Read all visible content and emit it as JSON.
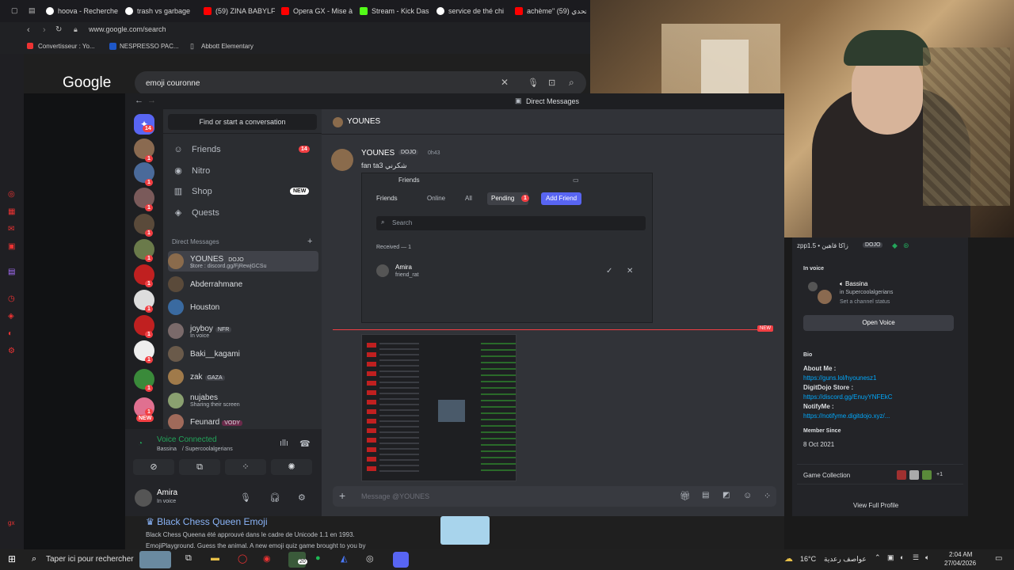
{
  "browser": {
    "tabs": [
      {
        "label": "hoova - Recherche",
        "color": "#ffffff"
      },
      {
        "label": "trash vs garbage",
        "color": "#ffffff"
      },
      {
        "label": "(59) ZINA BABYLF",
        "color": "#ff0000"
      },
      {
        "label": "Opera GX - Mise à",
        "color": "#ff0000"
      },
      {
        "label": "Stream - Kick Das",
        "color": "#53fc18"
      },
      {
        "label": "service de thé chi",
        "color": "#ffffff"
      },
      {
        "label": "‏achème\" تحدي (59)",
        "color": "#ff0000"
      }
    ],
    "url": "www.google.com/search",
    "bookmarks": [
      "Convertisseur : Yo...",
      "NESPRESSO PAC...",
      "Abbott Elementary"
    ],
    "search_query": "emoji couronne",
    "google_logo": "Google"
  },
  "discord": {
    "top_title": "Direct Messages",
    "find_placeholder": "Find or start a conversation",
    "nav": {
      "friends": "Friends",
      "friends_badge": "14",
      "nitro": "Nitro",
      "shop": "Shop",
      "shop_badge": "NEW",
      "quests": "Quests"
    },
    "dm_header": "Direct Messages",
    "dms": [
      {
        "name": "YOUNES",
        "tag": "DOJO",
        "sub": "$tore : discord.gg/FjRewjGCSu",
        "color": "#8a6b4c"
      },
      {
        "name": "Abderrahmane",
        "tag": "",
        "sub": "",
        "color": "#5a4a3a"
      },
      {
        "name": "Houston",
        "tag": "",
        "sub": "",
        "color": "#3a6aa0"
      },
      {
        "name": "joyboy",
        "tag": "NFR",
        "sub": "In voice",
        "color": "#7a6a6a"
      },
      {
        "name": "Baki__kagami",
        "tag": "",
        "sub": "",
        "color": "#6a5a4a"
      },
      {
        "name": "zak",
        "tag": "GAZA",
        "sub": "",
        "color": "#a07a4a"
      },
      {
        "name": "nujabes",
        "tag": "",
        "sub": "Sharing their screen",
        "color": "#8aa070"
      },
      {
        "name": "Feunard",
        "tag": "VODY",
        "sub": "",
        "color": "#a06a5a"
      }
    ],
    "server_badges": [
      "14",
      "1",
      "1",
      "1",
      "1",
      "1",
      "1",
      "1",
      "1",
      "1",
      "1",
      "1",
      "NEW"
    ],
    "voice": {
      "title": "Voice Connected",
      "channel": "Bassina / Supercoolalgerians"
    },
    "user": {
      "name": "Amira",
      "status": "In voice"
    },
    "chat": {
      "recipient": "YOUNES",
      "msg_author": "YOUNES",
      "msg_tag": "DOJO",
      "msg_time": "0h43",
      "msg_text": "fan ta3 شكرني",
      "embed": {
        "title": "Friends",
        "tabs": [
          "Friends",
          "Online",
          "All",
          "Pending",
          "Add Friend"
        ],
        "pending_count": "1",
        "search_placeholder": "Search",
        "received": "Received — 1",
        "req_name": "Amira",
        "req_sub": "friend_rat"
      },
      "new_label": "NEW",
      "input_placeholder": "Message @YOUNES"
    },
    "profile": {
      "header": "zpp1.5 • زاكا قاهين",
      "header_tag": "DOJO",
      "in_voice": "In voice",
      "voice_channel": "Bassina ",
      "voice_server": "in Supercoolalgerians",
      "set_status": "Set a channel status",
      "open_voice": "Open Voice",
      "bio_label": "Bio",
      "about_label": "About Me :",
      "about_link": "https://guns.lol/hyounesz1",
      "store_label": "DigitDojo Store :",
      "store_link": "https://discord.gg/EnuyYNFEkC",
      "notify_label": "NotifyMe :",
      "notify_link": "https://notifyme.digitdojo.xyz/...",
      "member_since_label": "Member Since",
      "member_since": "8 Oct 2021",
      "game_collection": "Game Collection",
      "game_more": "+1",
      "view_full": "View Full Profile"
    }
  },
  "below": {
    "result_title": "Black Chess Queen Emoji",
    "line1": "Black Chess Queena été approuvé dans le cadre de Unicode 1.1 en 1993.",
    "line2": "EmojiPlayground. Guess the animal. A new emoji quiz game brought to you by"
  },
  "taskbar": {
    "search": "Taper ici pour rechercher",
    "badge": "20",
    "temp": "16°C",
    "weather": "عواصف رعدية",
    "time": "2:04 AM",
    "date": "27/04/2026"
  }
}
